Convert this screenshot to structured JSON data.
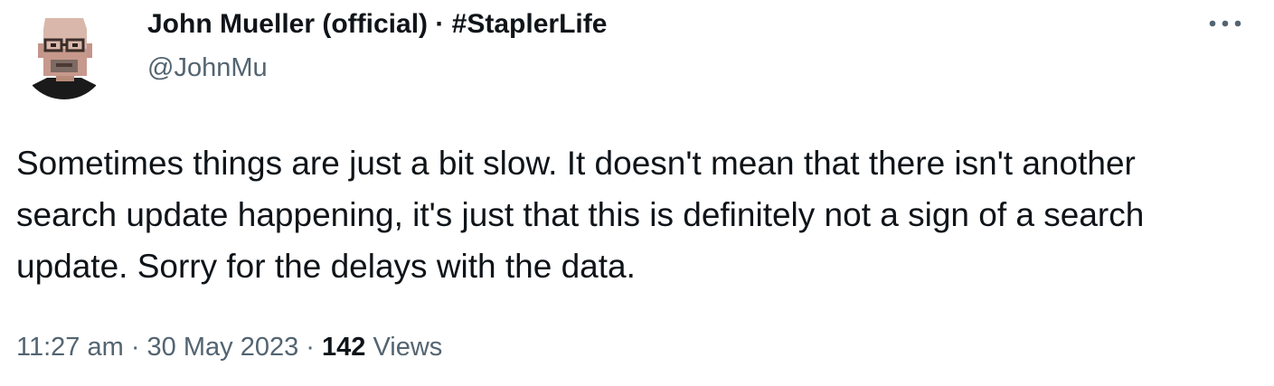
{
  "author": {
    "display_name": "John Mueller (official) · #StaplerLife",
    "handle": "@JohnMu",
    "avatar_icon": "pixel-art-portrait-avatar"
  },
  "more_menu": {
    "icon": "more-horizontal-icon"
  },
  "tweet": {
    "text": "Sometimes things are just a bit slow. It doesn't mean that there isn't another search update happening, it's just that this is definitely not a sign of a search update. Sorry for the delays with the data."
  },
  "meta": {
    "time": "11:27 am",
    "separator1": " · ",
    "date": "30 May 2023",
    "separator2": " · ",
    "views_count": "142",
    "views_label": " Views"
  },
  "colors": {
    "primary_text": "#0f1419",
    "secondary_text": "#536471",
    "background": "#ffffff"
  }
}
